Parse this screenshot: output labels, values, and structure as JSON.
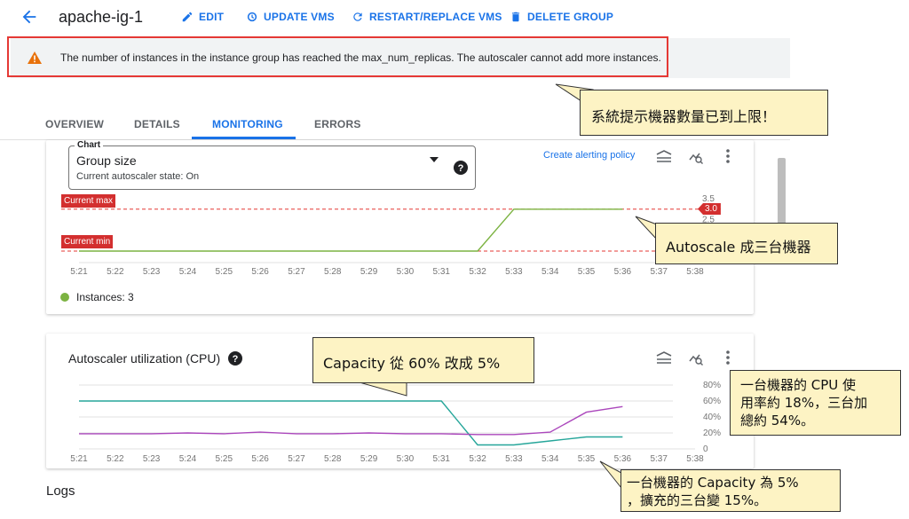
{
  "header": {
    "title": "apache-ig-1",
    "actions": {
      "edit": "EDIT",
      "update_vms": "UPDATE VMS",
      "restart_replace": "RESTART/REPLACE VMS",
      "delete_group": "DELETE GROUP"
    }
  },
  "banner": {
    "message": "The number of instances in the instance group has reached the max_num_replicas. The autoscaler cannot add more instances."
  },
  "annotations": {
    "limit_reached": "系統提示機器數量已到上限！",
    "autoscale_three": "Autoscale 成三台機器",
    "capacity_change": "Capacity 從 60% 改成 5%",
    "cpu_usage_line1": "一台機器的 CPU 使",
    "cpu_usage_line2": "用率約 18%，三台加",
    "cpu_usage_line3": "總約 54%。",
    "capacity_line1": "一台機器的 Capacity 為 5%",
    "capacity_line2": "，擴充的三台變 15%。"
  },
  "tabs": [
    {
      "label": "OVERVIEW",
      "active": false
    },
    {
      "label": "DETAILS",
      "active": false
    },
    {
      "label": "MONITORING",
      "active": true
    },
    {
      "label": "ERRORS",
      "active": false
    }
  ],
  "group_size_card": {
    "select_label": "Chart",
    "select_value": "Group size",
    "select_subtext": "Current autoscaler state: On",
    "create_alert": "Create alerting policy",
    "current_max_label": "Current max",
    "current_min_label": "Current min",
    "current_value_badge": "3.0",
    "legend": "Instances: 3"
  },
  "cpu_card": {
    "title": "Autoscaler utilization (CPU)"
  },
  "logs_title": "Logs",
  "chart_data": [
    {
      "type": "line",
      "title": "Group size",
      "x": [
        "5:21",
        "5:22",
        "5:23",
        "5:24",
        "5:25",
        "5:26",
        "5:27",
        "5:28",
        "5:29",
        "5:30",
        "5:31",
        "5:32",
        "5:33",
        "5:34",
        "5:35",
        "5:36",
        "5:37",
        "5:38"
      ],
      "yticks": [
        "2.5",
        "3.5"
      ],
      "ylim": [
        1,
        3.5
      ],
      "reference_lines": {
        "current_max": 3,
        "current_min": 1
      },
      "series": [
        {
          "name": "Instances",
          "color": "#7cb342",
          "values": [
            1,
            1,
            1,
            1,
            1,
            1,
            1,
            1,
            1,
            1,
            1,
            1,
            3,
            3,
            3,
            3,
            null,
            null
          ]
        }
      ]
    },
    {
      "type": "line",
      "title": "Autoscaler utilization (CPU)",
      "x": [
        "5:21",
        "5:22",
        "5:23",
        "5:24",
        "5:25",
        "5:26",
        "5:27",
        "5:28",
        "5:29",
        "5:30",
        "5:31",
        "5:32",
        "5:33",
        "5:34",
        "5:35",
        "5:36",
        "5:37",
        "5:38"
      ],
      "yticks": [
        "0",
        "20%",
        "40%",
        "60%",
        "80%"
      ],
      "ylim": [
        0,
        80
      ],
      "series": [
        {
          "color": "#26a69a",
          "values": [
            60,
            60,
            60,
            60,
            60,
            60,
            60,
            60,
            60,
            60,
            60,
            5,
            5,
            10,
            15,
            15,
            null,
            null
          ]
        },
        {
          "color": "#ab47bc",
          "values": [
            19,
            19,
            19,
            20,
            19,
            21,
            19,
            19,
            20,
            19,
            19,
            18,
            18,
            21,
            46,
            53,
            null,
            null
          ]
        }
      ]
    }
  ],
  "colors": {
    "accent": "#1a73e8",
    "alert_red": "#d32f2f",
    "banner_bg": "#f1f3f4",
    "callout_bg": "#fdf3c4"
  }
}
